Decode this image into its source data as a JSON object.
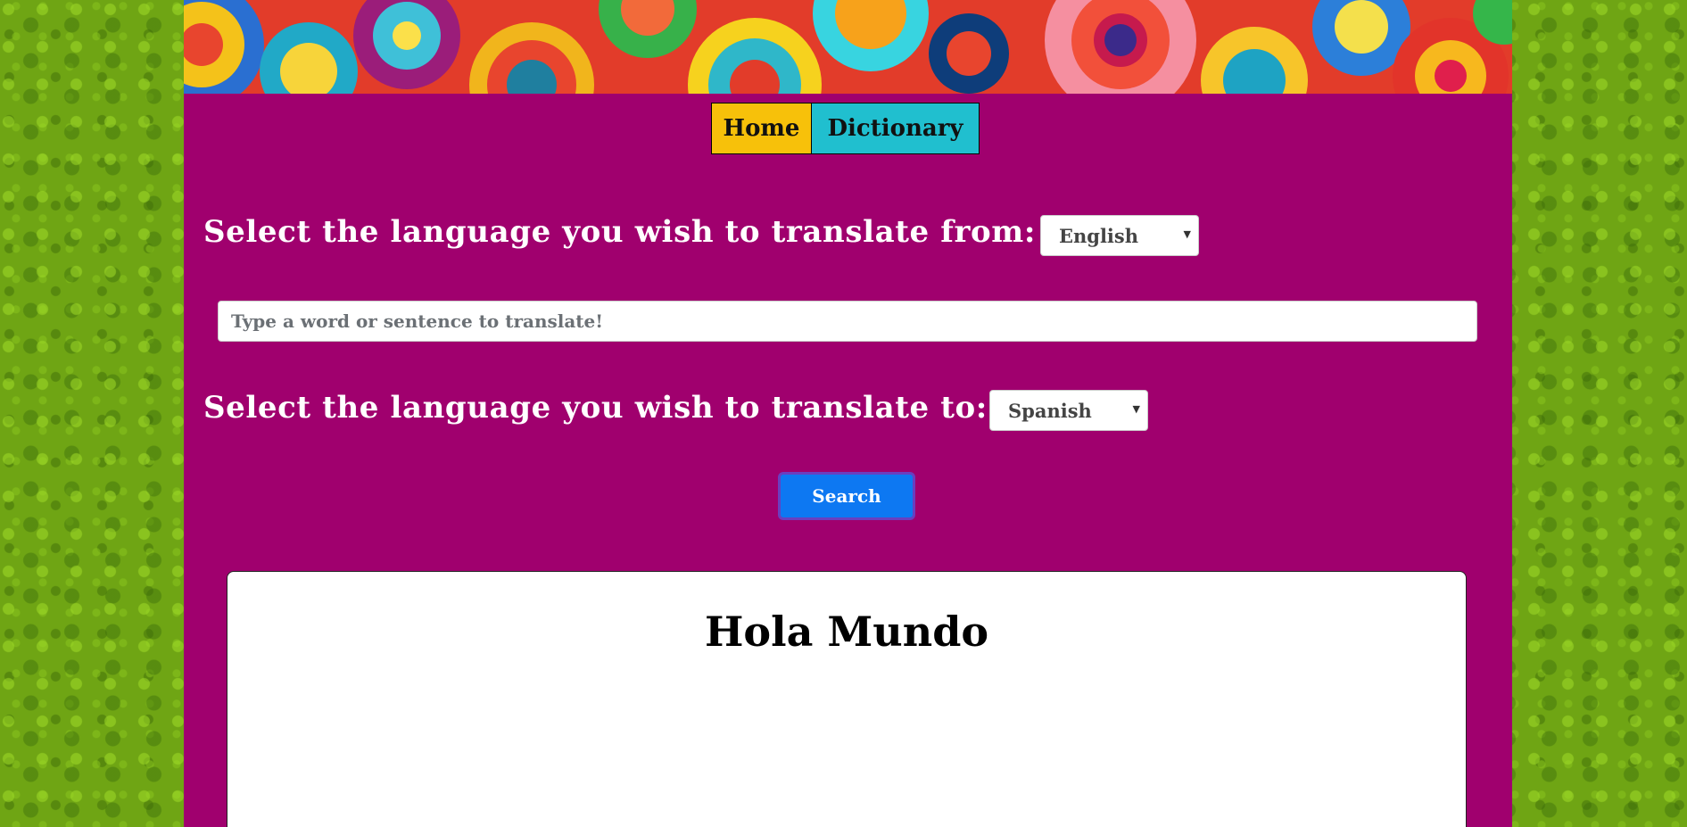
{
  "nav": {
    "home_label": "Home",
    "dictionary_label": "Dictionary"
  },
  "form": {
    "from_label": "Select the language you wish to translate from:",
    "from_selected": "English",
    "input_placeholder": "Type a word or sentence to translate!",
    "input_value": "",
    "to_label": "Select the language you wish to translate to:",
    "to_selected": "Spanish",
    "search_label": "Search"
  },
  "result": {
    "text": "Hola Mundo"
  },
  "colors": {
    "page_background": "#6fa514",
    "container_background": "#a0006e",
    "home_tab": "#f7c10a",
    "dictionary_tab": "#20bfcf",
    "search_button": "#0d78f2"
  }
}
